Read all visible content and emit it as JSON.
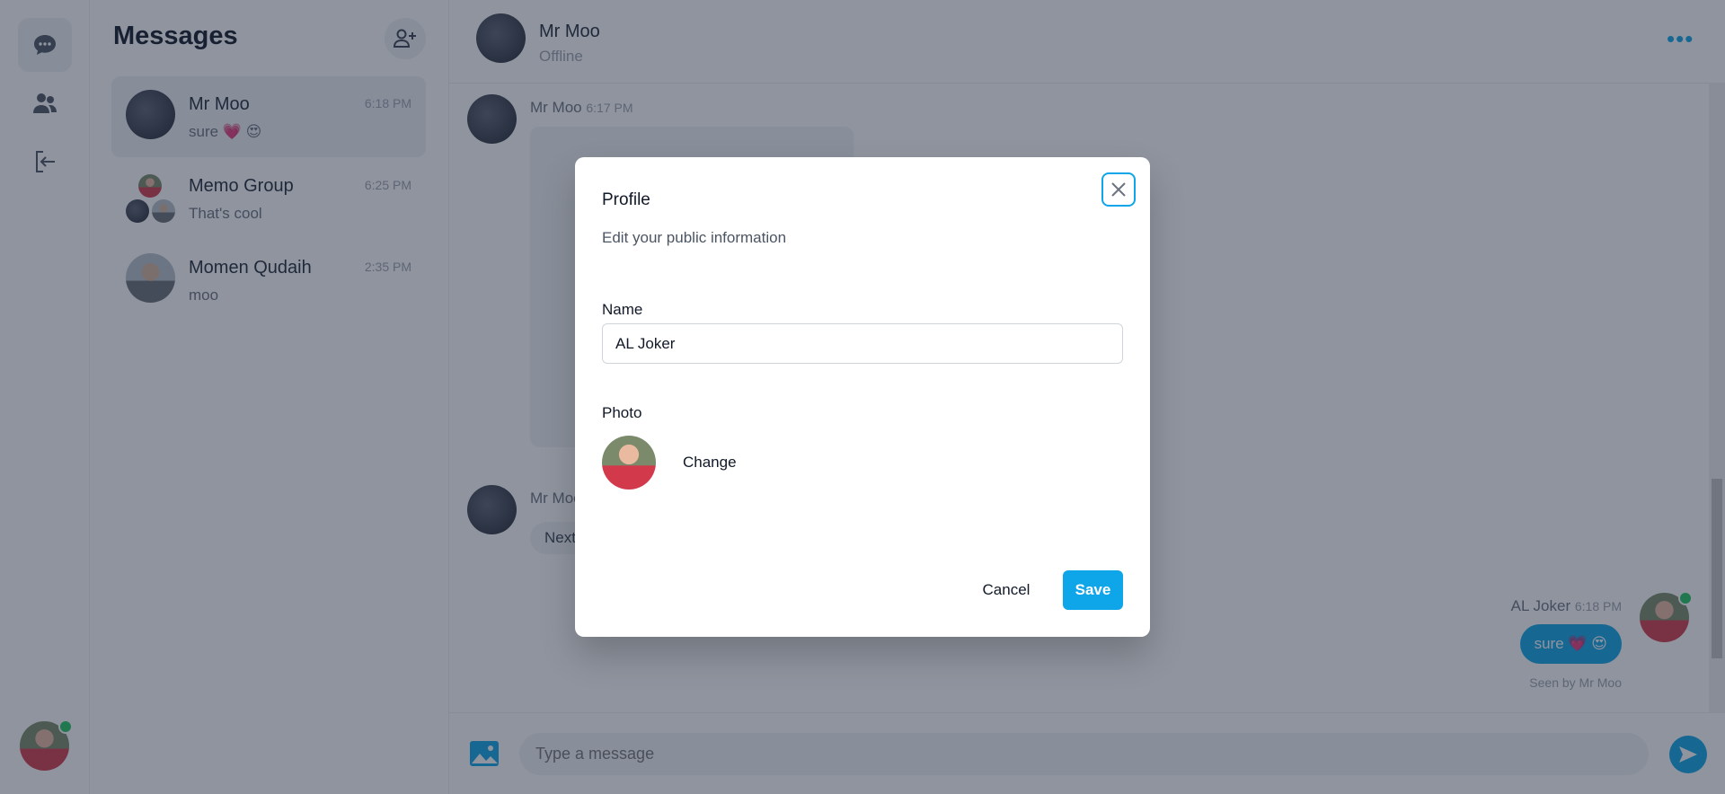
{
  "sidebar": {
    "items": [
      {
        "icon": "chat-icon",
        "active": true
      },
      {
        "icon": "users-icon"
      },
      {
        "icon": "logout-icon"
      }
    ],
    "user_online": true
  },
  "list": {
    "title": "Messages",
    "add_icon": "add-user-icon",
    "conversations": [
      {
        "name": "Mr Moo",
        "time": "6:18 PM",
        "preview": "sure 💗 😍",
        "active": true
      },
      {
        "name": "Memo Group",
        "time": "6:25 PM",
        "preview": "That's cool"
      },
      {
        "name": "Momen Qudaih",
        "time": "2:35 PM",
        "preview": "moo"
      }
    ]
  },
  "chat": {
    "name": "Mr Moo",
    "status": "Offline",
    "messages": [
      {
        "sender": "Mr Moo",
        "time": "6:17 PM"
      },
      {
        "sender": "Mr Moo",
        "text": "Next"
      },
      {
        "sender": "AL Joker",
        "time": "6:18 PM",
        "text": "sure 💗 😍",
        "seen": "Seen by Mr Moo"
      }
    ],
    "composer_placeholder": "Type a message"
  },
  "modal": {
    "title": "Profile",
    "subtitle": "Edit your public information",
    "name_label": "Name",
    "name_value": "AL Joker",
    "photo_label": "Photo",
    "change_label": "Change",
    "cancel_label": "Cancel",
    "save_label": "Save"
  },
  "colors": {
    "accent": "#0ea5e9",
    "online": "#22c55e"
  }
}
